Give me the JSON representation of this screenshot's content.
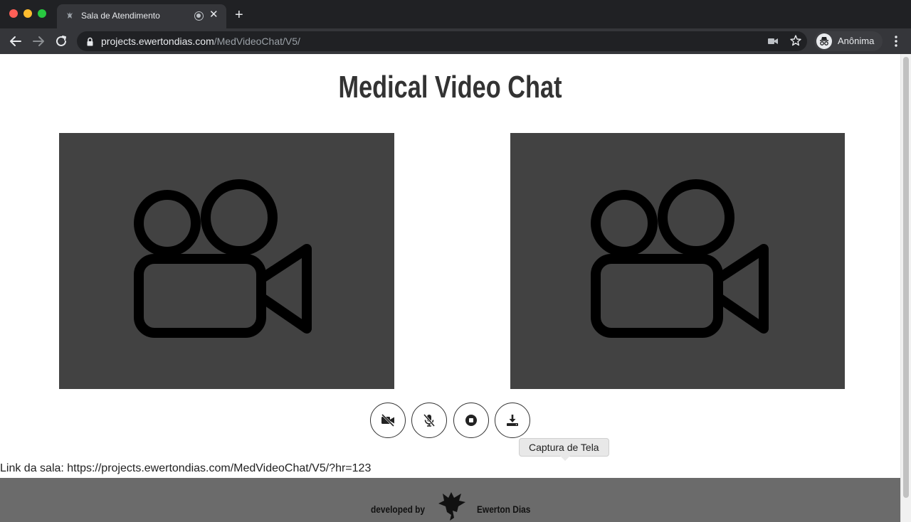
{
  "browser": {
    "tab_title": "Sala de Atendimento",
    "tab_close": "✕",
    "new_tab": "+",
    "url_host": "projects.ewertondias.com",
    "url_path": "/MedVideoChat/V5/",
    "profile_label": "Anônima"
  },
  "page": {
    "title": "Medical Video Chat",
    "room_link_label": "Link da sala: ",
    "room_link_url": "https://projects.ewertondias.com/MedVideoChat/V5/?hr=123"
  },
  "controls": {
    "icons": [
      "video-off-icon",
      "mic-off-icon",
      "stop-icon",
      "download-icon"
    ]
  },
  "footer": {
    "developed_by": "developed by",
    "author": "Ewerton Dias"
  },
  "tooltip": {
    "text": "Captura de Tela"
  },
  "colors": {
    "video_placeholder": "#424242",
    "footer_bg": "#6b6b6b",
    "title": "#333333"
  }
}
